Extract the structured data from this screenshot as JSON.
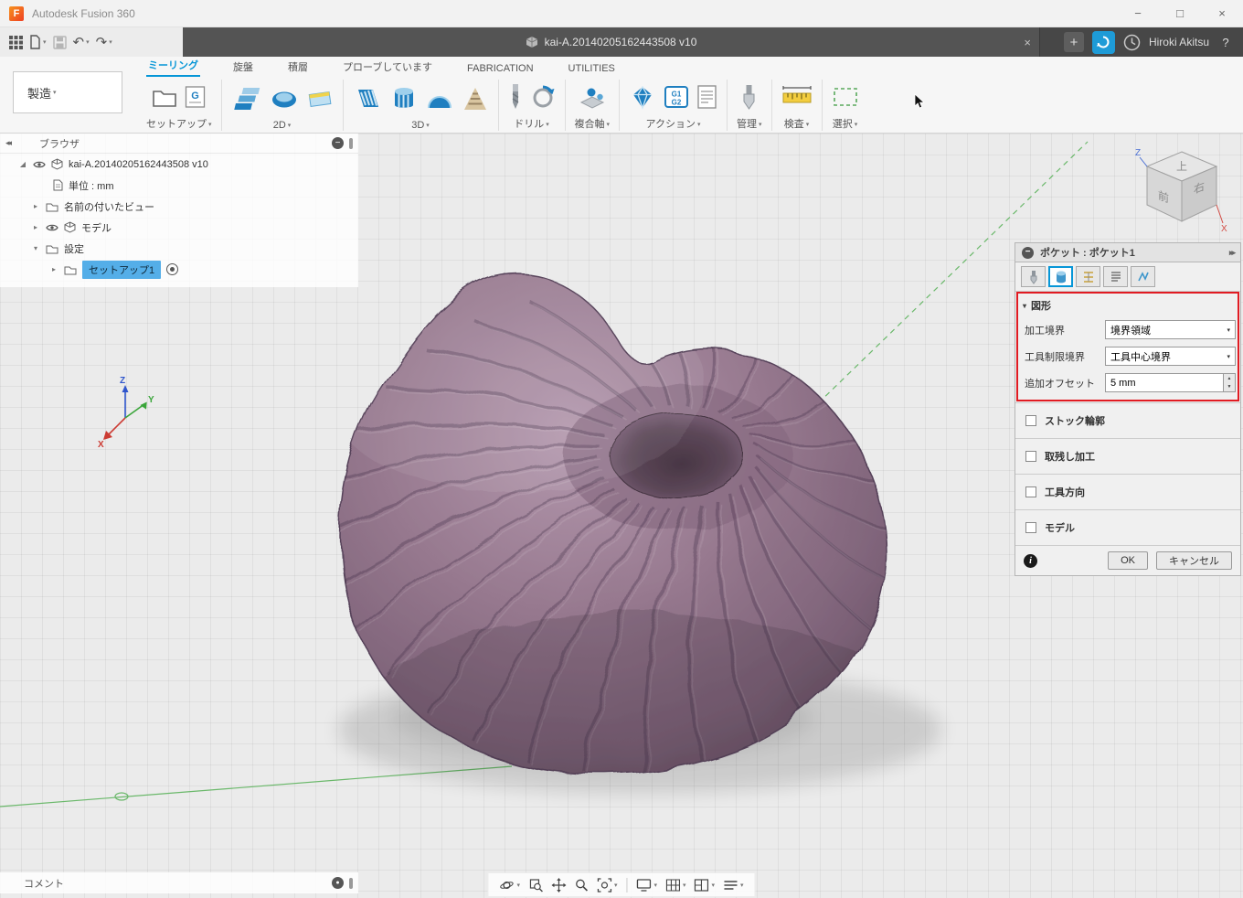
{
  "colors": {
    "accent": "#0696d7",
    "annotation": "#e11b22",
    "selection_blue": "#54aee8",
    "model_purple": "#8f7289"
  },
  "title_bar": {
    "title": "Autodesk Fusion 360"
  },
  "window_controls": {
    "minimize": "−",
    "maximize": "□",
    "close": "×"
  },
  "document_bar": {
    "tab_title": "kai-A.20140205162443508 v10",
    "close": "×",
    "new_tab": "+",
    "user": "Hiroki Akitsu",
    "help": "?"
  },
  "icons": {
    "undo": "↶",
    "redo": "↷",
    "collapse_left": "◂◂",
    "expand_right": "▸▸",
    "minus": "−",
    "tri_right": "▸",
    "tri_down": "▾",
    "flag": "◢",
    "spin_up": "▲",
    "spin_down": "▼",
    "info": "i",
    "dot": "●"
  },
  "ribbon": {
    "workspace_label": "製造",
    "tabs": [
      "ミーリング",
      "旋盤",
      "積層",
      "プローブしています",
      "FABRICATION",
      "UTILITIES"
    ],
    "groups": [
      "セットアップ",
      "2D",
      "3D",
      "ドリル",
      "複合軸",
      "アクション",
      "管理",
      "検査",
      "選択"
    ]
  },
  "browser": {
    "title": "ブラウザ",
    "root": "kai-A.20140205162443508 v10",
    "unit": "単位 : mm",
    "named_views": "名前の付いたビュー",
    "model": "モデル",
    "settings": "設定",
    "setup": "セットアップ1"
  },
  "dialog": {
    "title": "ポケット : ポケット1",
    "geometry_header": "図形",
    "rows": [
      {
        "label": "加工境界",
        "value": "境界領域"
      },
      {
        "label": "工具制限境界",
        "value": "工具中心境界"
      },
      {
        "label": "追加オフセット",
        "value": "5 mm"
      }
    ],
    "sections": [
      "ストック輪郭",
      "取残し加工",
      "工具方向",
      "モデル"
    ],
    "ok": "OK",
    "cancel": "キャンセル"
  },
  "viewcube": {
    "top": "上",
    "front": "前",
    "right": "右",
    "z": "Z",
    "x": "X"
  },
  "triad": {
    "x": "X",
    "y": "Y",
    "z": "Z"
  },
  "comment_bar": {
    "label": "コメント"
  }
}
